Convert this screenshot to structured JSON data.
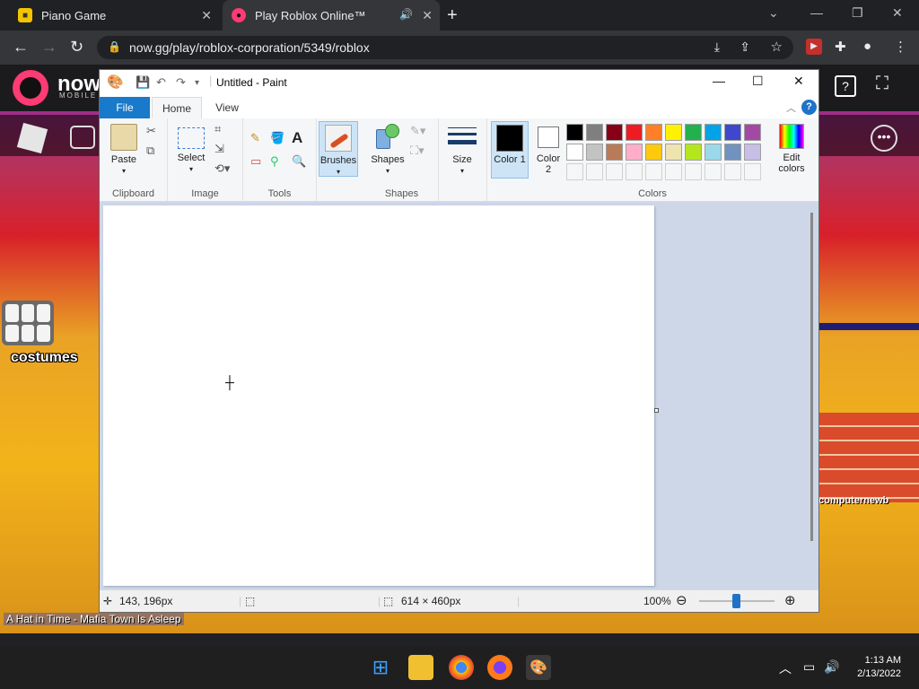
{
  "browser": {
    "tabs": [
      {
        "title": "Piano Game"
      },
      {
        "title": "Play Roblox Online™"
      }
    ],
    "url": "now.gg/play/roblox-corporation/5349/roblox"
  },
  "game": {
    "brand": "now",
    "brand_sub": "MOBILE",
    "costumes_label": "costumes",
    "song_text": "A Hat in Time - Mafia Town Is Asleep",
    "username": "computernewb"
  },
  "paint": {
    "title": "Untitled - Paint",
    "menu": {
      "file": "File",
      "home": "Home",
      "view": "View"
    },
    "groups": {
      "clipboard": "Clipboard",
      "image": "Image",
      "tools": "Tools",
      "shapes": "Shapes",
      "colors": "Colors"
    },
    "buttons": {
      "paste": "Paste",
      "select": "Select",
      "brushes": "Brushes",
      "shapes": "Shapes",
      "size": "Size",
      "color1": "Color 1",
      "color2": "Color 2",
      "edit_colors": "Edit colors"
    },
    "palette_row1": [
      "#000000",
      "#7f7f7f",
      "#880015",
      "#ed1c24",
      "#ff7f27",
      "#fff200",
      "#22b14c",
      "#00a2e8",
      "#3f48cc",
      "#a349a4"
    ],
    "palette_row2": [
      "#ffffff",
      "#c3c3c3",
      "#b97a57",
      "#ffaec9",
      "#ffc90e",
      "#efe4b0",
      "#b5e61d",
      "#99d9ea",
      "#7092be",
      "#c8bfe7"
    ],
    "status": {
      "cursor_pos": "143, 196px",
      "canvas_size": "614 × 460px",
      "zoom": "100%"
    }
  },
  "taskbar": {
    "time": "1:13 AM",
    "date": "2/13/2022"
  }
}
